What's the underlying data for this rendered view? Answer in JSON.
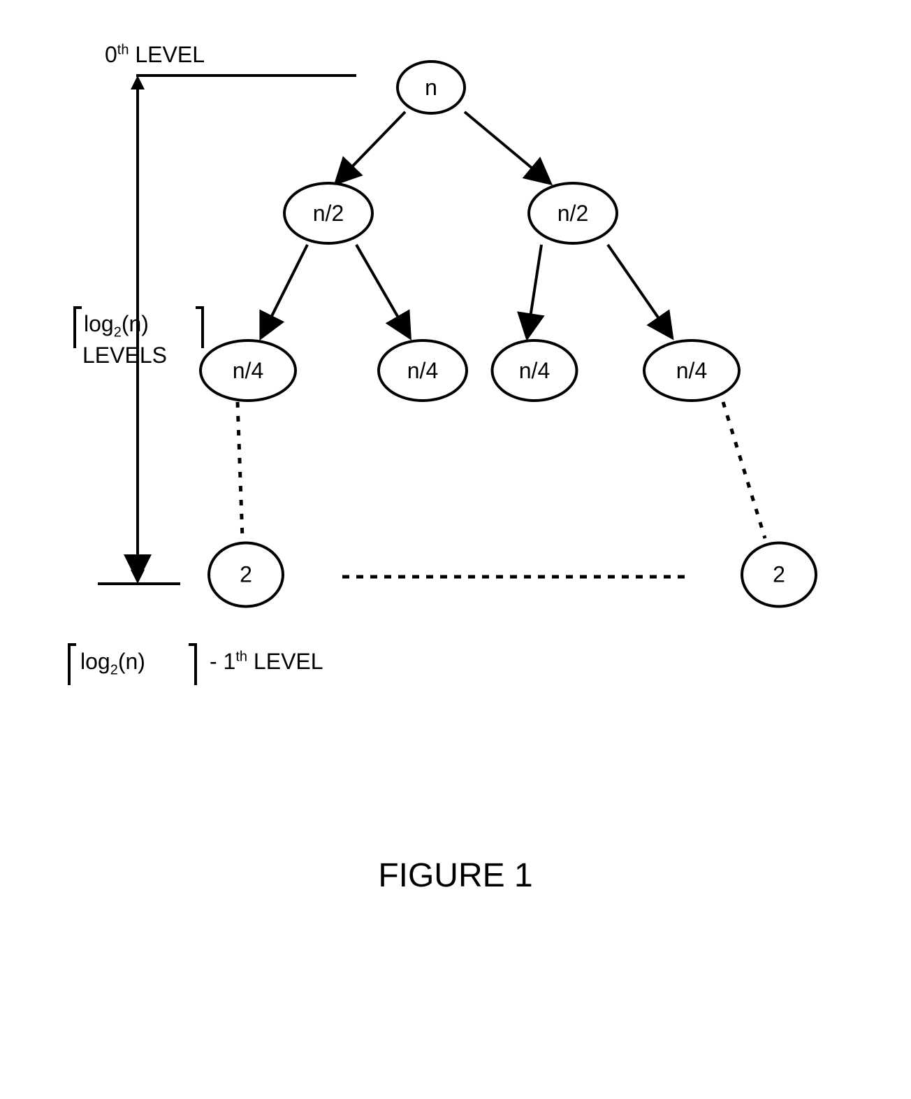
{
  "nodes": {
    "root": "n",
    "level1_left": "n/2",
    "level1_right": "n/2",
    "level2_1": "n/4",
    "level2_2": "n/4",
    "level2_3": "n/4",
    "level2_4": "n/4",
    "leaf_left": "2",
    "leaf_right": "2"
  },
  "labels": {
    "top_level": "0",
    "top_level_suffix": " LEVEL",
    "top_level_sup": "th",
    "levels_count": "log",
    "levels_count_sub": "2",
    "levels_count_arg": "(n)",
    "levels_suffix": "LEVELS",
    "bottom_level": "log",
    "bottom_level_sub": "2",
    "bottom_level_arg": "(n)",
    "bottom_level_suffix": " LEVEL",
    "bottom_level_minus": "- 1",
    "bottom_level_sup": "th"
  },
  "title": "FIGURE 1"
}
